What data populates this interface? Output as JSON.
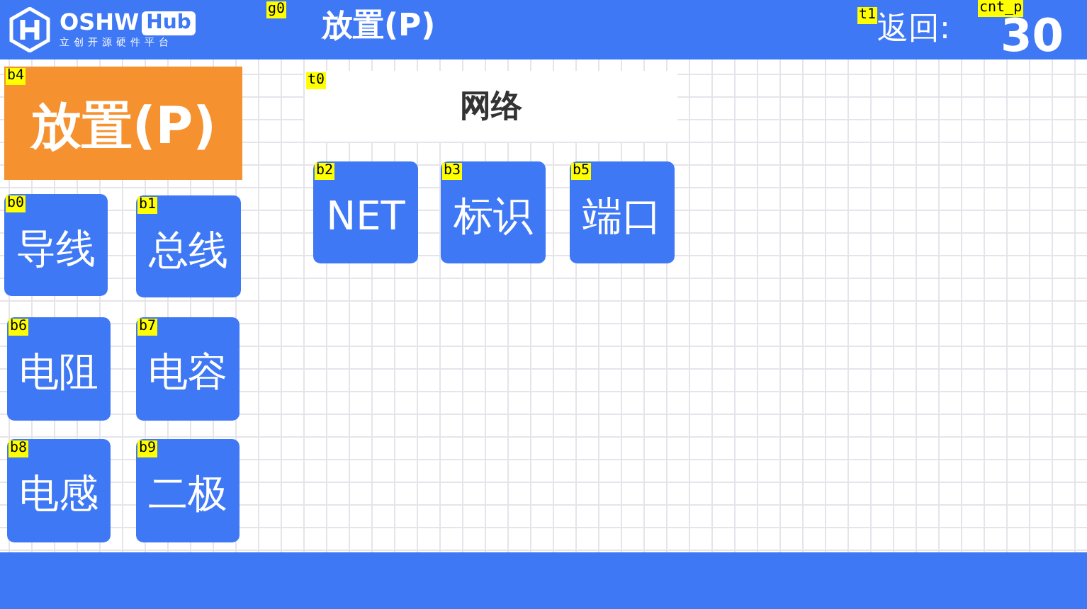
{
  "header": {
    "logo": {
      "word": "OSHW",
      "badge": "Hub",
      "subtitle": "立创开源硬件平台"
    },
    "title_tag": "g0",
    "title": "放置(P)",
    "back_tag": "t1",
    "back_label": "返回:",
    "count_tag": "cnt_p",
    "count": "30"
  },
  "widgets": [
    {
      "kind": "banner",
      "tag": "b4",
      "text": "放置(P)"
    },
    {
      "kind": "button",
      "tag": "b0",
      "text": "导线"
    },
    {
      "kind": "button",
      "tag": "b1",
      "text": "总线"
    },
    {
      "kind": "button",
      "tag": "b6",
      "text": "电阻"
    },
    {
      "kind": "button",
      "tag": "b7",
      "text": "电容"
    },
    {
      "kind": "button",
      "tag": "b8",
      "text": "电感"
    },
    {
      "kind": "button",
      "tag": "b9",
      "text": "二极"
    },
    {
      "kind": "label",
      "tag": "t0",
      "text": "网络"
    },
    {
      "kind": "button",
      "tag": "b2",
      "text": "NET"
    },
    {
      "kind": "button",
      "tag": "b3",
      "text": "标识"
    },
    {
      "kind": "button",
      "tag": "b5",
      "text": "端口"
    }
  ]
}
